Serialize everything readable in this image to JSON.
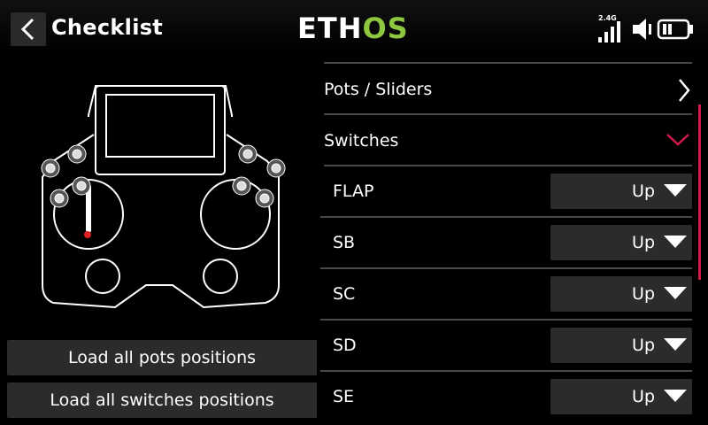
{
  "header": {
    "title": "Checklist",
    "logo_main": "ETH",
    "logo_accent": "OS",
    "rf_label": "2.4G",
    "accent_color": "#8dc63f"
  },
  "left": {
    "load_pots_label": "Load all pots positions",
    "load_switches_label": "Load all switches positions"
  },
  "sections": {
    "pots": {
      "label": "Pots / Sliders",
      "icon": "chevron-right-icon",
      "expanded": false
    },
    "switches": {
      "label": "Switches",
      "icon": "chevron-down-icon",
      "expanded": true,
      "accent": "#d11a4a"
    }
  },
  "switches": [
    {
      "name": "FLAP",
      "value": "Up"
    },
    {
      "name": "SB",
      "value": "Up"
    },
    {
      "name": "SC",
      "value": "Up"
    },
    {
      "name": "SD",
      "value": "Up"
    },
    {
      "name": "SE",
      "value": "Up"
    }
  ]
}
